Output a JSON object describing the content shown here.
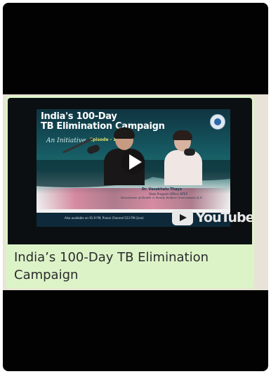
{
  "video": {
    "title_line1": "India's 100-Day",
    "title_line2": "TB Elimination Campaign",
    "signature": "An Initiative",
    "episode": "Episode - 1",
    "speaker_name": "Dr. Vasakhalu Thayo",
    "speaker_role": "State Program Officer NTEP",
    "speaker_directorate": "Directorate of Health & Family Welfare Government of N",
    "availability": "Also available on 91.9 FM, Prasar Channel 523 FM (Live)",
    "platform": "YouTube"
  },
  "message": {
    "caption": "India’s 100-Day TB Elimination Campaign"
  },
  "colors": {
    "bubble": "#dcf3c8",
    "background": "#020202",
    "chat_bg": "#e9e2d6"
  }
}
